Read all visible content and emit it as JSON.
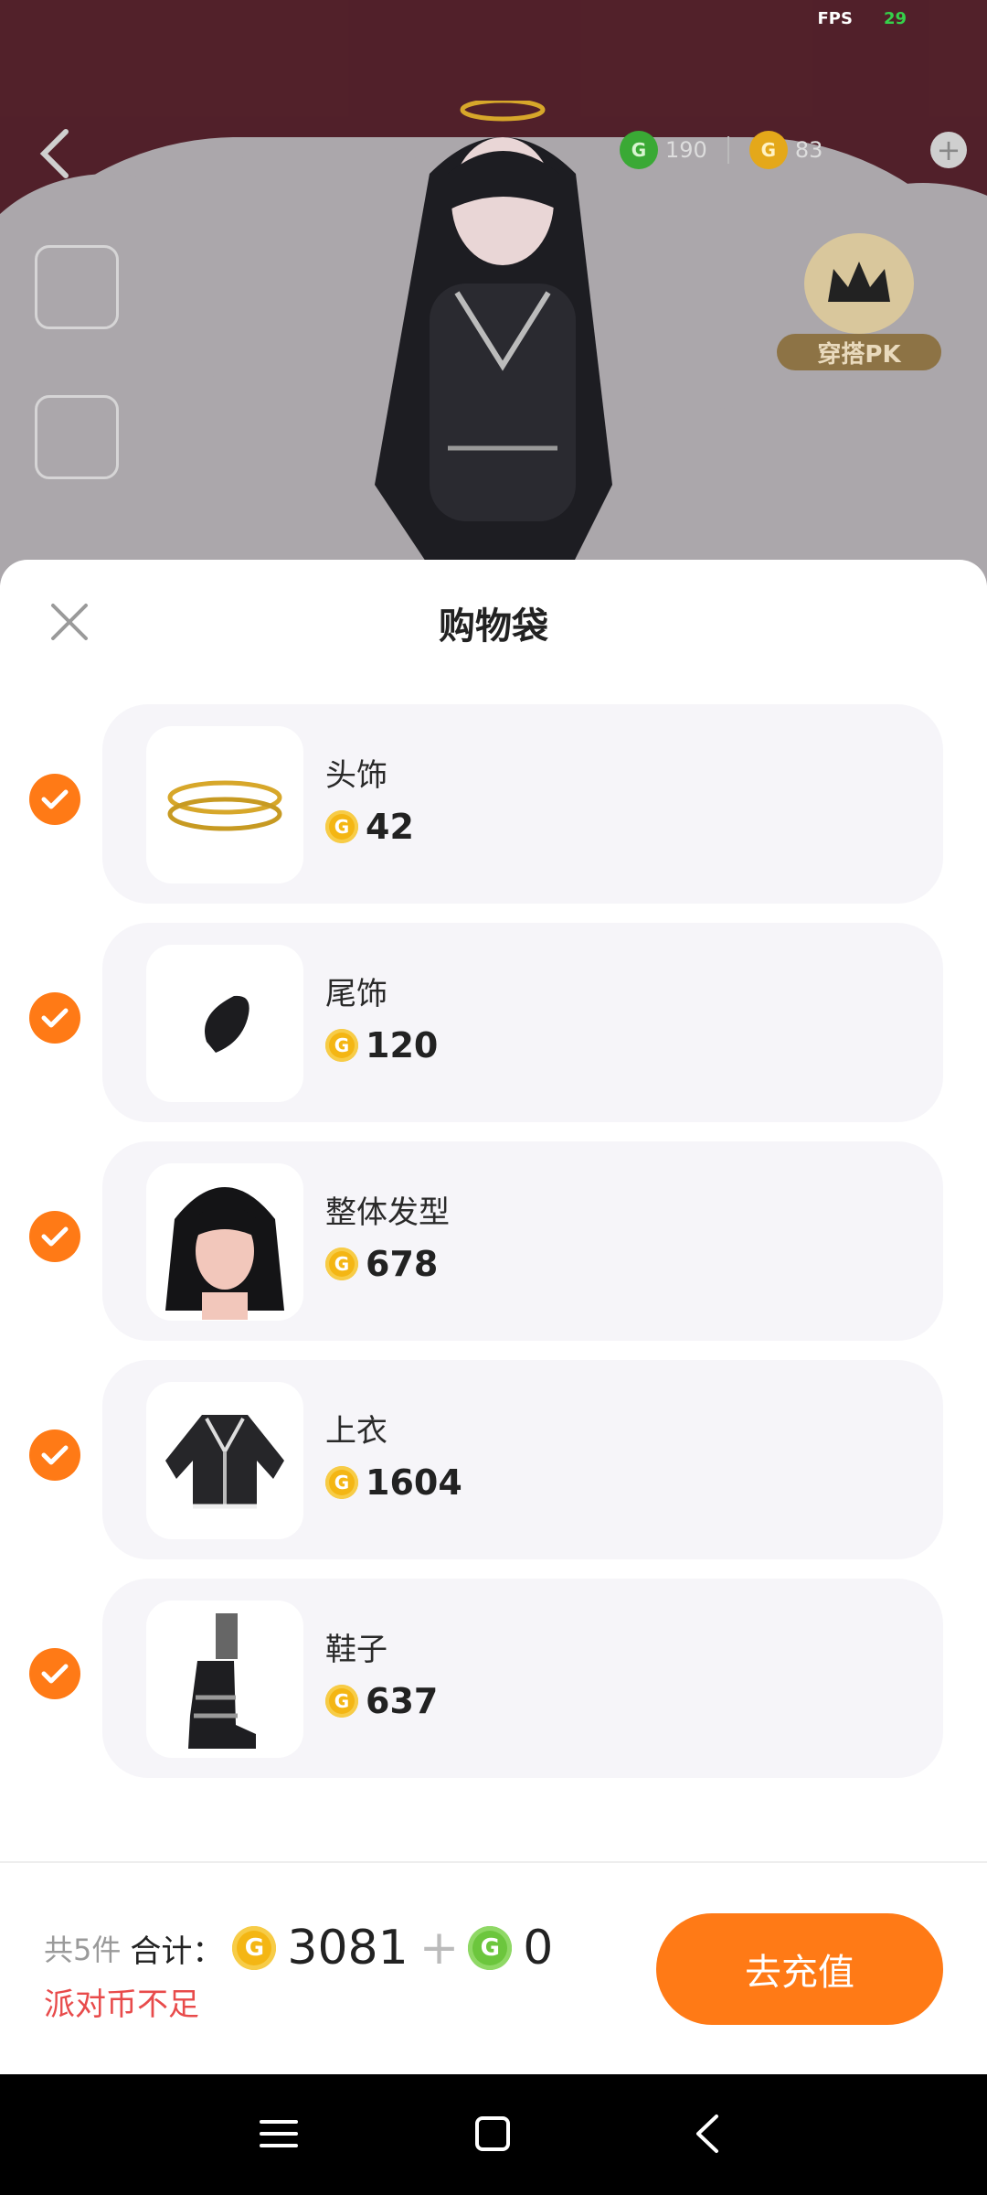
{
  "status": {
    "fps_label": "FPS",
    "fps_value": "29"
  },
  "scene": {
    "currency_green": "190",
    "currency_gold": "83",
    "pk_badge_label": "穿搭PK"
  },
  "sheet": {
    "title": "购物袋",
    "items": [
      {
        "name": "头饰",
        "price": "42",
        "icon": "halo-icon"
      },
      {
        "name": "尾饰",
        "price": "120",
        "icon": "tail-icon"
      },
      {
        "name": "整体发型",
        "price": "678",
        "icon": "hairstyle-icon"
      },
      {
        "name": "上衣",
        "price": "1604",
        "icon": "jacket-icon"
      },
      {
        "name": "鞋子",
        "price": "637",
        "icon": "boots-icon"
      }
    ]
  },
  "footer": {
    "count_text": "共5件",
    "total_label": "合计：",
    "gold_total": "3081",
    "plus": "+",
    "green_total": "0",
    "warning": "派对币不足",
    "recharge_label": "去充值"
  },
  "colors": {
    "accent": "#ff7a16",
    "warning": "#e84b4b",
    "gold_coin": "#f4b614",
    "green_coin": "#6cc63d"
  }
}
